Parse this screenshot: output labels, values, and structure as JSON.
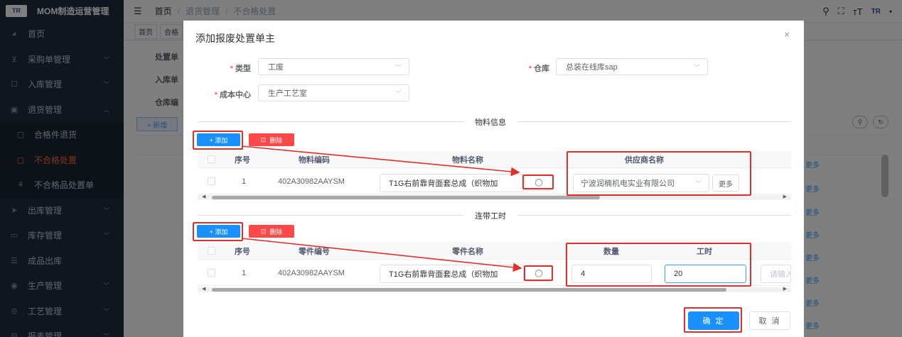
{
  "app": {
    "title": "MOM制造运营管理",
    "logo": "TR"
  },
  "sidebar": {
    "items": [
      {
        "label": "首页",
        "icon": "dashboard-icon"
      },
      {
        "label": "采购单管理",
        "icon": "cart-icon"
      },
      {
        "label": "入库管理",
        "icon": "edit-icon"
      },
      {
        "label": "退货管理",
        "icon": "return-icon"
      },
      {
        "label": "合格件退货",
        "icon": "doc-icon"
      },
      {
        "label": "不合格处置",
        "icon": "doc-icon"
      },
      {
        "label": "不合格品处置单",
        "icon": "shuffle-icon"
      },
      {
        "label": "出库管理",
        "icon": "send-icon"
      },
      {
        "label": "库存管理",
        "icon": "box-icon"
      },
      {
        "label": "成品出库",
        "icon": "list-icon"
      },
      {
        "label": "生产管理",
        "icon": "gear-icon"
      },
      {
        "label": "工艺管理",
        "icon": "tool-icon"
      },
      {
        "label": "报表管理",
        "icon": "chart-icon"
      }
    ]
  },
  "breadcrumb": {
    "home": "首页",
    "parent": "退货管理",
    "current": "不合格处置",
    "sep": "/"
  },
  "tags": [
    "首页",
    "合格"
  ],
  "background": {
    "labels": [
      "处置单",
      "入库单",
      "仓库编"
    ],
    "add_label": "+ 新增",
    "more_label": "更多"
  },
  "dialog": {
    "title": "添加报废处置单主",
    "close": "×",
    "form": {
      "type_label": "类型",
      "type_value": "工废",
      "warehouse_label": "仓库",
      "warehouse_value": "总装在线库sap",
      "cost_center_label": "成本中心",
      "cost_center_value": "生产工艺室"
    },
    "material_section": {
      "title": "物料信息",
      "add_label": "+ 添加",
      "delete_label": "删除",
      "headers": [
        "序号",
        "物料编码",
        "物料名称",
        "供应商名称"
      ],
      "rows": [
        {
          "index": "1",
          "code": "402A30982AAYSM",
          "name": "T1G右前靠背面套总成（织物加",
          "supplier": "宁波润楠机电实业有限公司",
          "more": "更多"
        }
      ]
    },
    "labor_section": {
      "title": "连带工时",
      "add_label": "+ 添加",
      "delete_label": "删除",
      "headers": [
        "序号",
        "零件编号",
        "零件名称",
        "数量",
        "工时"
      ],
      "rows": [
        {
          "index": "1",
          "code": "402A30982AAYSM",
          "name": "T1G右前靠背面套总成（织物加",
          "quantity": "4",
          "hours": "20",
          "extra_placeholder": "请输入"
        }
      ]
    },
    "ok_label": "确 定",
    "cancel_label": "取 消"
  },
  "annotation_color": "#e0302b"
}
